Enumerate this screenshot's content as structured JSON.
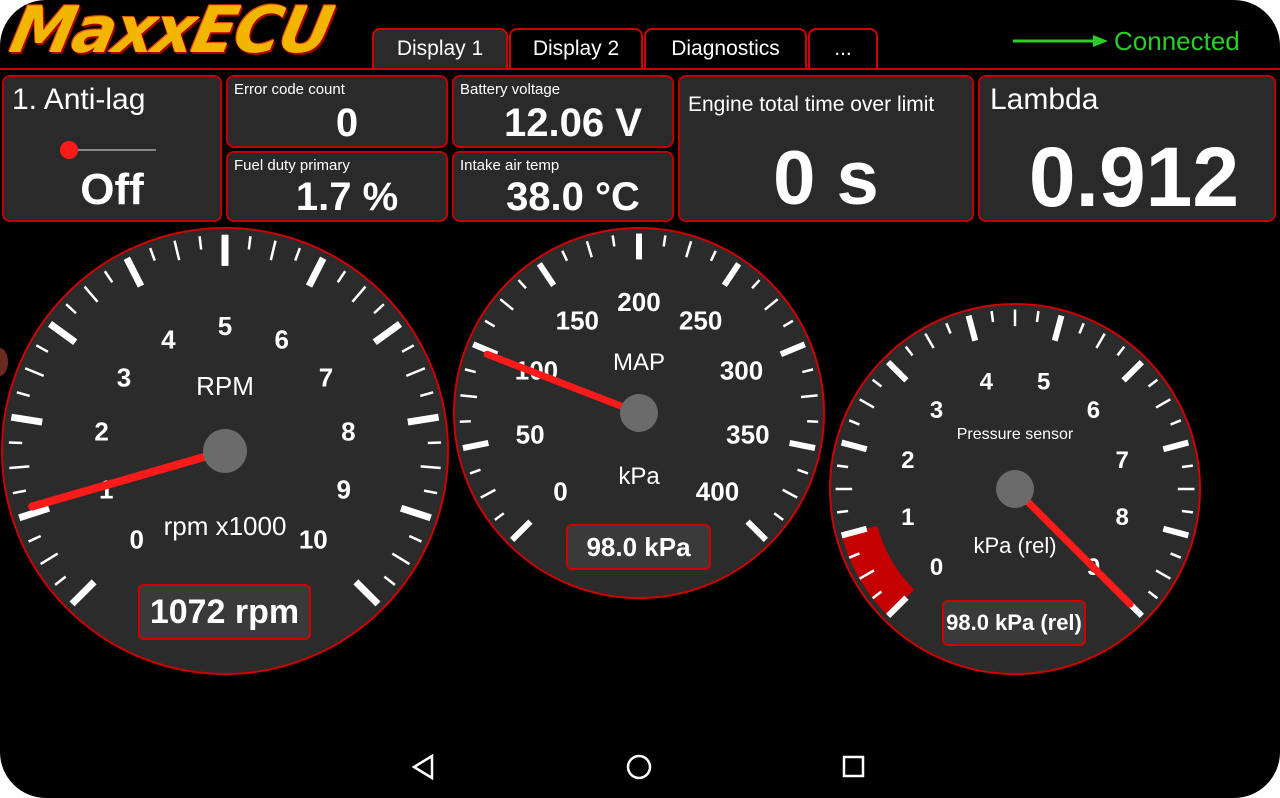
{
  "app": {
    "logo_text": "MaxxECU",
    "status": "Connected"
  },
  "tabs": [
    {
      "label": "Display 1",
      "active": true
    },
    {
      "label": "Display 2",
      "active": false
    },
    {
      "label": "Diagnostics",
      "active": false
    },
    {
      "label": "...",
      "active": false
    }
  ],
  "panels": {
    "antilag": {
      "label": "1. Anti-lag",
      "value": "Off",
      "switch_on": false
    },
    "error_code": {
      "label": "Error code count",
      "value": "0"
    },
    "fuel_duty": {
      "label": "Fuel duty primary",
      "value": "1.7 %"
    },
    "battery": {
      "label": "Battery voltage",
      "value": "12.06 V"
    },
    "intake_air": {
      "label": "Intake air temp",
      "value": "38.0 °C"
    },
    "engine_time": {
      "label": "Engine total time over limit",
      "value": "0 s"
    },
    "lambda": {
      "label": "Lambda",
      "value": "0.912"
    }
  },
  "gauges": {
    "rpm": {
      "title": "RPM",
      "unit": "rpm x1000",
      "ticks": [
        "0",
        "1",
        "2",
        "3",
        "4",
        "5",
        "6",
        "7",
        "8",
        "9",
        "10"
      ],
      "min": 0,
      "max": 10,
      "value": 1.072,
      "readout": "1072 rpm"
    },
    "map": {
      "title": "MAP",
      "unit": "kPa",
      "ticks": [
        "0",
        "50",
        "100",
        "150",
        "200",
        "250",
        "300",
        "350",
        "400"
      ],
      "min": 0,
      "max": 400,
      "value": 98.0,
      "readout": "98.0 kPa"
    },
    "pressure": {
      "title": "Pressure sensor",
      "unit": "kPa (rel)",
      "ticks": [
        "0",
        "1",
        "2",
        "3",
        "4",
        "5",
        "6",
        "7",
        "8",
        "9"
      ],
      "min": 0,
      "max": 9,
      "value": 9,
      "readout": "98.0 kPa (rel)",
      "red_zone": [
        0,
        1
      ]
    }
  },
  "colors": {
    "accent": "#d00000",
    "connected": "#27cf27",
    "panel_bg": "#2a2a2a",
    "gauge_bg": "#2b2b2b",
    "needle": "#ff1a1a",
    "hub": "#6b6b6b"
  },
  "navbar": {
    "icons": [
      "back-icon",
      "home-icon",
      "recents-icon"
    ]
  }
}
